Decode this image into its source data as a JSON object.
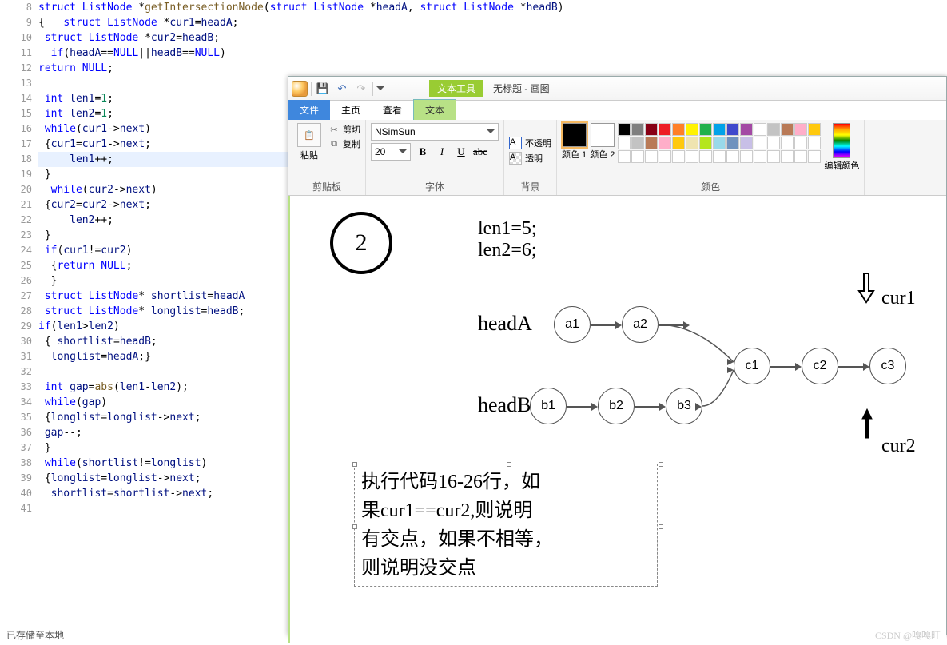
{
  "code": {
    "lines": [
      {
        "n": 8,
        "html": "<span class='kw'>struct</span> <span class='type'>ListNode</span> *<span class='fn'>getIntersectionNode</span>(<span class='kw'>struct</span> <span class='type'>ListNode</span> *<span class='var'>headA</span>, <span class='kw'>struct</span> <span class='type'>ListNode</span> *<span class='var'>headB</span>)"
      },
      {
        "n": 9,
        "html": "{   <span class='kw'>struct</span> <span class='type'>ListNode</span> *<span class='var'>cur1</span>=<span class='var'>headA</span>;"
      },
      {
        "n": 10,
        "html": " <span class='kw'>struct</span> <span class='type'>ListNode</span> *<span class='var'>cur2</span>=<span class='var'>headB</span>;"
      },
      {
        "n": 11,
        "html": "  <span class='kw'>if</span>(<span class='var'>headA</span>==<span class='null'>NULL</span>||<span class='var'>headB</span>==<span class='null'>NULL</span>)"
      },
      {
        "n": 12,
        "html": "<span class='kw'>return</span> <span class='null'>NULL</span>;"
      },
      {
        "n": 13,
        "html": ""
      },
      {
        "n": 14,
        "html": " <span class='kw'>int</span> <span class='var'>len1</span>=<span class='num'>1</span>;"
      },
      {
        "n": 15,
        "html": " <span class='kw'>int</span> <span class='var'>len2</span>=<span class='num'>1</span>;"
      },
      {
        "n": 16,
        "html": " <span class='kw'>while</span>(<span class='var'>cur1</span>-><span class='var'>next</span>)"
      },
      {
        "n": 17,
        "html": " {<span class='var'>cur1</span>=<span class='var'>cur1</span>-><span class='var'>next</span>;"
      },
      {
        "n": 18,
        "html": "     <span class='var'>len1</span>++;",
        "hl": true
      },
      {
        "n": 19,
        "html": " }"
      },
      {
        "n": 20,
        "html": "  <span class='kw'>while</span>(<span class='var'>cur2</span>-><span class='var'>next</span>)"
      },
      {
        "n": 21,
        "html": " {<span class='var'>cur2</span>=<span class='var'>cur2</span>-><span class='var'>next</span>;"
      },
      {
        "n": 22,
        "html": "     <span class='var'>len2</span>++;"
      },
      {
        "n": 23,
        "html": " }"
      },
      {
        "n": 24,
        "html": " <span class='kw'>if</span>(<span class='var'>cur1</span>!=<span class='var'>cur2</span>)"
      },
      {
        "n": 25,
        "html": "  {<span class='kw'>return</span> <span class='null'>NULL</span>;"
      },
      {
        "n": 26,
        "html": "  }"
      },
      {
        "n": 27,
        "html": " <span class='kw'>struct</span> <span class='type'>ListNode</span>* <span class='var'>shortlist</span>=<span class='var'>headA</span>"
      },
      {
        "n": 28,
        "html": " <span class='kw'>struct</span> <span class='type'>ListNode</span>* <span class='var'>longlist</span>=<span class='var'>headB</span>;"
      },
      {
        "n": 29,
        "html": "<span class='kw'>if</span>(<span class='var'>len1</span>><span class='var'>len2</span>)"
      },
      {
        "n": 30,
        "html": " { <span class='var'>shortlist</span>=<span class='var'>headB</span>;"
      },
      {
        "n": 31,
        "html": "  <span class='var'>longlist</span>=<span class='var'>headA</span>;}"
      },
      {
        "n": 32,
        "html": ""
      },
      {
        "n": 33,
        "html": " <span class='kw'>int</span> <span class='var'>gap</span>=<span class='fn'>abs</span>(<span class='var'>len1</span>-<span class='var'>len2</span>);"
      },
      {
        "n": 34,
        "html": " <span class='kw'>while</span>(<span class='var'>gap</span>)"
      },
      {
        "n": 35,
        "html": " {<span class='var'>longlist</span>=<span class='var'>longlist</span>-><span class='var'>next</span>;"
      },
      {
        "n": 36,
        "html": " <span class='var'>gap</span>--;"
      },
      {
        "n": 37,
        "html": " }"
      },
      {
        "n": 38,
        "html": " <span class='kw'>while</span>(<span class='var'>shortlist</span>!=<span class='var'>longlist</span>)"
      },
      {
        "n": 39,
        "html": " {<span class='var'>longlist</span>=<span class='var'>longlist</span>-><span class='var'>next</span>;"
      },
      {
        "n": 40,
        "html": "  <span class='var'>shortlist</span>=<span class='var'>shortlist</span>-><span class='var'>next</span>;"
      },
      {
        "n": 41,
        "html": ""
      }
    ]
  },
  "status": "已存储至本地",
  "paint": {
    "title": "无标题 - 画图",
    "text_tools": "文本工具",
    "tabs": {
      "file": "文件",
      "home": "主页",
      "view": "查看",
      "text": "文本"
    },
    "clipboard": {
      "paste": "粘贴",
      "cut": "剪切",
      "copy": "复制",
      "group": "剪贴板"
    },
    "font": {
      "name": "NSimSun",
      "size": "20",
      "group": "字体"
    },
    "bg": {
      "opaque": "不透明",
      "transparent": "透明",
      "group": "背景"
    },
    "colors": {
      "c1": "颜色 1",
      "c2": "颜色 2",
      "edit": "编辑颜色",
      "group": "颜色"
    },
    "palette_colors": [
      "#000000",
      "#7f7f7f",
      "#880015",
      "#ed1c24",
      "#ff7f27",
      "#fff200",
      "#22b14c",
      "#00a2e8",
      "#3f48cc",
      "#a349a4",
      "#ffffff",
      "#c3c3c3",
      "#b97a57",
      "#ffaec9",
      "#ffc90e",
      "#ffffff",
      "#c3c3c3",
      "#b97a57",
      "#ffaec9",
      "#ffc90e",
      "#efe4b0",
      "#b5e61d",
      "#99d9ea",
      "#7092be",
      "#c8bfe7",
      "#ffffff",
      "#ffffff",
      "#ffffff",
      "#ffffff",
      "#ffffff",
      "#ffffff",
      "#ffffff",
      "#ffffff",
      "#ffffff",
      "#ffffff",
      "#ffffff",
      "#ffffff",
      "#ffffff",
      "#ffffff",
      "#ffffff",
      "#ffffff",
      "#ffffff",
      "#ffffff",
      "#ffffff",
      "#ffffff"
    ]
  },
  "canvas": {
    "circle_num": "2",
    "len_text": "len1=5;\nlen2=6;",
    "headA": "headA",
    "headB": "headB",
    "cur1": "cur1",
    "cur2": "cur2",
    "nodes": {
      "a1": "a1",
      "a2": "a2",
      "b1": "b1",
      "b2": "b2",
      "b3": "b3",
      "c1": "c1",
      "c2": "c2",
      "c3": "c3"
    },
    "textbox": "执行代码16-26行，如\n果cur1==cur2,则说明\n有交点，如果不相等，\n则说明没交点"
  },
  "watermark": "CSDN @嘎嘎旺"
}
